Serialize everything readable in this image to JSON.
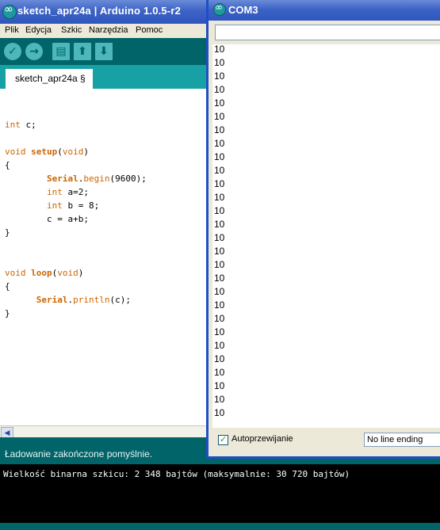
{
  "ide": {
    "title": "sketch_apr24a | Arduino 1.0.5-r2",
    "menu": [
      "Plik",
      "Edycja",
      "Szkic",
      "Narzędzia",
      "Pomoc"
    ],
    "toolbar": {
      "verify_icon": "check-icon",
      "upload_icon": "arrow-right-icon",
      "new_icon": "new-file-icon",
      "open_icon": "arrow-up-icon",
      "save_icon": "arrow-down-icon"
    },
    "tab_label": "sketch_apr24a §",
    "status": "Ładowanie zakończone pomyślnie.",
    "console": "Wielkość binarna szkicu: 2 348 bajtów (maksymalnie: 30 720 bajtów)"
  },
  "code": {
    "lines": [
      "int c;",
      "",
      "void setup(void)",
      "{",
      "        Serial.begin(9600);",
      "        int a=2;",
      "        int b = 8;",
      "        c = a+b;",
      "}",
      "",
      "",
      "void loop(void)",
      "{",
      "      Serial.println(c);",
      "}"
    ]
  },
  "serial_monitor": {
    "title": "COM3",
    "send_value": "",
    "output_lines": [
      "10",
      "10",
      "10",
      "10",
      "10",
      "10",
      "10",
      "10",
      "10",
      "10",
      "10",
      "10",
      "10",
      "10",
      "10",
      "10",
      "10",
      "10",
      "10",
      "10",
      "10",
      "10",
      "10",
      "10",
      "10",
      "10",
      "10",
      "10"
    ],
    "autoscroll_label": "Autoprzewijanie",
    "autoscroll_checked": true,
    "line_ending": "No line ending"
  },
  "colors": {
    "teal_dark": "#006468",
    "teal_tab": "#17a1a5",
    "keyword": "#cc6600",
    "titlebar_blue": "#3d63c6"
  }
}
